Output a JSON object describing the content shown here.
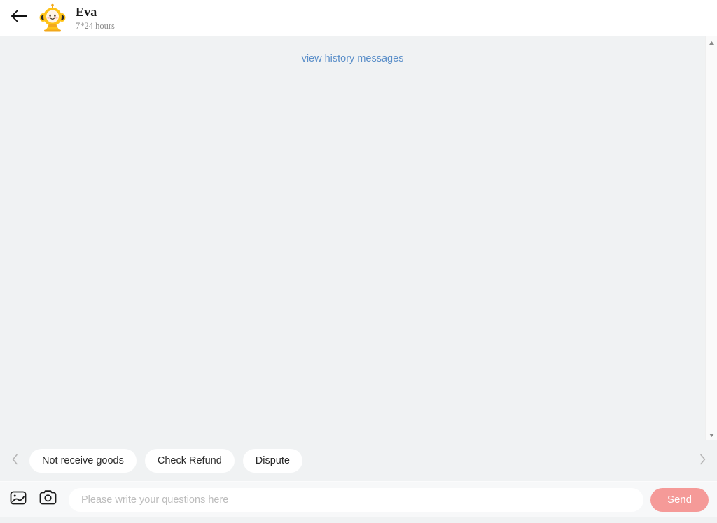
{
  "header": {
    "back_icon": "back-arrow-icon",
    "avatar_icon": "agent-avatar-mascot",
    "name": "Eva",
    "subtitle": "7*24 hours"
  },
  "chat": {
    "history_link": "view history messages",
    "messages": [],
    "background_color": "#f0f2f3"
  },
  "scrollbar": {
    "up_icon": "scroll-up-arrow-icon",
    "down_icon": "scroll-down-arrow-icon"
  },
  "quick_replies": {
    "prev_icon": "chevron-left-icon",
    "next_icon": "chevron-right-icon",
    "chips": [
      {
        "label": "Not receive goods"
      },
      {
        "label": "Check Refund"
      },
      {
        "label": "Dispute"
      }
    ]
  },
  "composer": {
    "gallery_icon": "image-gallery-icon",
    "camera_icon": "camera-icon",
    "input_value": "",
    "input_placeholder": "Please write your questions here",
    "send_label": "Send",
    "send_color": "#f59a98"
  }
}
